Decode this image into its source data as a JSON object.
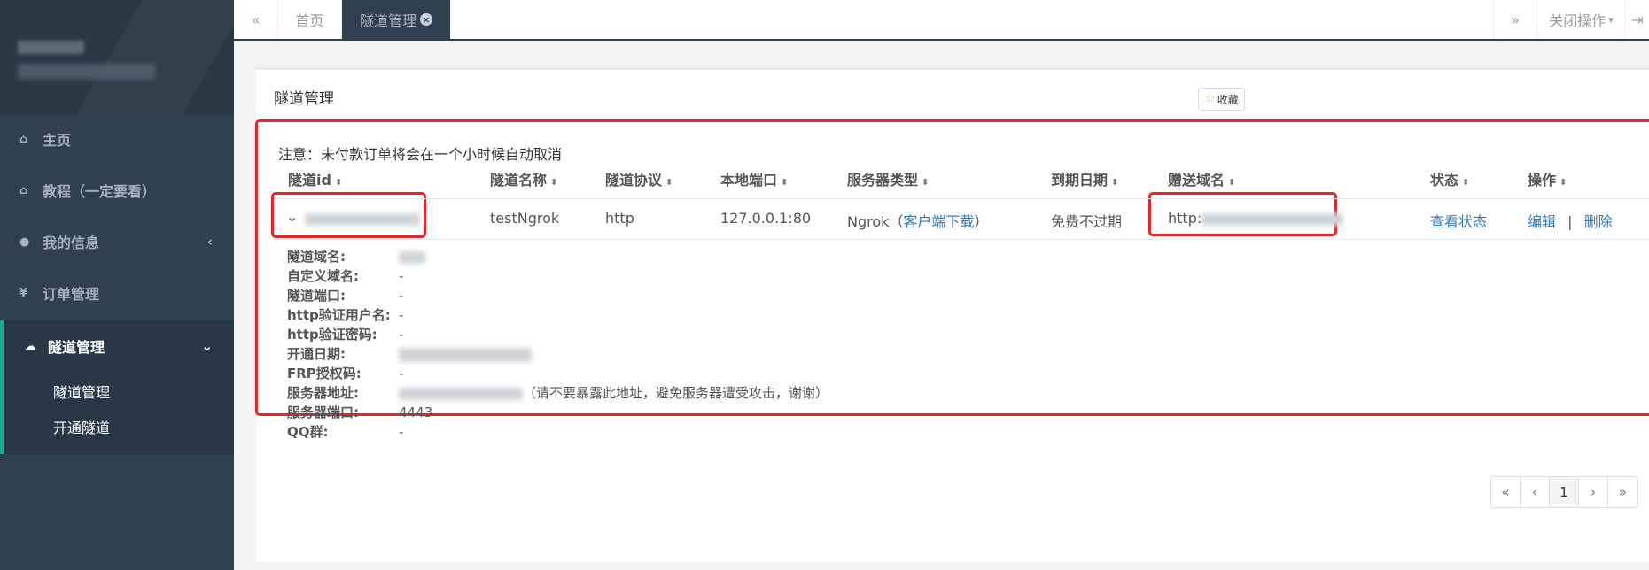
{
  "sidebar": {
    "items": [
      {
        "icon": "home-icon",
        "label": "主页"
      },
      {
        "icon": "home-icon",
        "label": "教程（一定要看）"
      },
      {
        "icon": "user-icon",
        "label": "我的信息",
        "arrow": "‹"
      },
      {
        "icon": "yen-icon",
        "label": "订单管理"
      },
      {
        "icon": "cloud-icon",
        "label": "隧道管理",
        "arrow": "⌄"
      }
    ],
    "subitems": [
      "隧道管理",
      "开通隧道"
    ]
  },
  "topbar": {
    "back": "«",
    "tabs": [
      {
        "label": "首页"
      },
      {
        "label": "隧道管理",
        "close": "×"
      }
    ],
    "forward": "»",
    "close_ops": "关闭操作",
    "close_ops_caret": "▾"
  },
  "panel": {
    "title": "隧道管理",
    "fav_label": "收藏",
    "notice": "注意：未付款订单将会在一个小时候自动取消",
    "columns": [
      "隧道id",
      "隧道名称",
      "隧道协议",
      "本地端口",
      "服务器类型",
      "到期日期",
      "赠送域名",
      "状态",
      "操作"
    ],
    "row": {
      "expand": "⌄",
      "name": "testNgrok",
      "protocol": "http",
      "local_port": "127.0.0.1:80",
      "server_type": "Ngrok（",
      "server_link": "客户端下载",
      "server_type_end": "）",
      "expiry": "免费不过期",
      "domain_prefix": "http:",
      "status_link": "查看状态",
      "edit": "编辑",
      "sep": "|",
      "delete": "删除"
    },
    "details": [
      {
        "key": "隧道域名:",
        "value": ""
      },
      {
        "key": "自定义域名:",
        "value": "-"
      },
      {
        "key": "隧道端口:",
        "value": "-"
      },
      {
        "key": "http验证用户名:",
        "value": "-"
      },
      {
        "key": "http验证密码:",
        "value": "-"
      },
      {
        "key": "开通日期:",
        "value": ""
      },
      {
        "key": "FRP授权码:",
        "value": "-"
      },
      {
        "key": "服务器地址:",
        "value": "",
        "note": "（请不要暴露此地址，避免服务器遭受攻击，谢谢）"
      },
      {
        "key": "服务器端口:",
        "value": "4443"
      },
      {
        "key": "QQ群:",
        "value": "-"
      }
    ],
    "pager": [
      "«",
      "‹",
      "1",
      "›",
      "»"
    ]
  }
}
